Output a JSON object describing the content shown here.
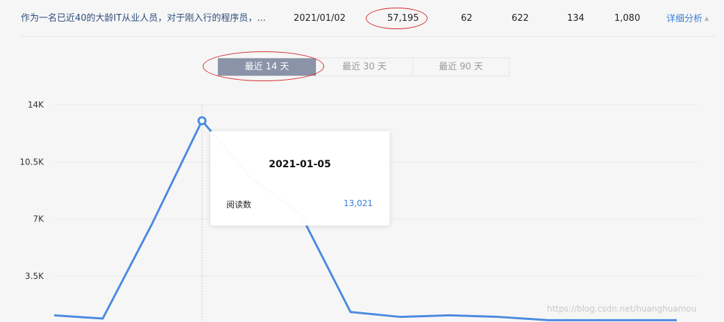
{
  "article_row": {
    "title": "作为一名已近40的大龄IT从业人员，对于刚入行的程序员，...",
    "date": "2021/01/02",
    "reads": "57,195",
    "col_a": "62",
    "col_b": "622",
    "col_c": "134",
    "col_d": "1,080",
    "detail_label": "详细分析",
    "detail_caret": "▲"
  },
  "range_tabs": [
    {
      "label": "最近 14 天",
      "active": true
    },
    {
      "label": "最近 30 天",
      "active": false
    },
    {
      "label": "最近 90 天",
      "active": false
    }
  ],
  "tooltip": {
    "date": "2021-01-05",
    "metric_label": "阅读数",
    "metric_value": "13,021"
  },
  "watermark": "https://blog.csdn.net/huanghuamou",
  "colors": {
    "line": "#4a8ae0",
    "active_tab": "#8a93a7",
    "annotation_ring": "#d62b2b",
    "link": "#3a7ed8"
  },
  "chart_data": {
    "type": "line",
    "series": [
      {
        "values": [
          1100,
          900,
          6700,
          13021,
          9500,
          7300,
          1300,
          1000,
          1100,
          1000,
          800,
          800
        ]
      }
    ],
    "y_ticks": [
      "14K",
      "10.5K",
      "7K",
      "3.5K"
    ],
    "y_tick_values": [
      14000,
      10500,
      7000,
      3500
    ],
    "highlighted_index": 3,
    "grid": true
  }
}
